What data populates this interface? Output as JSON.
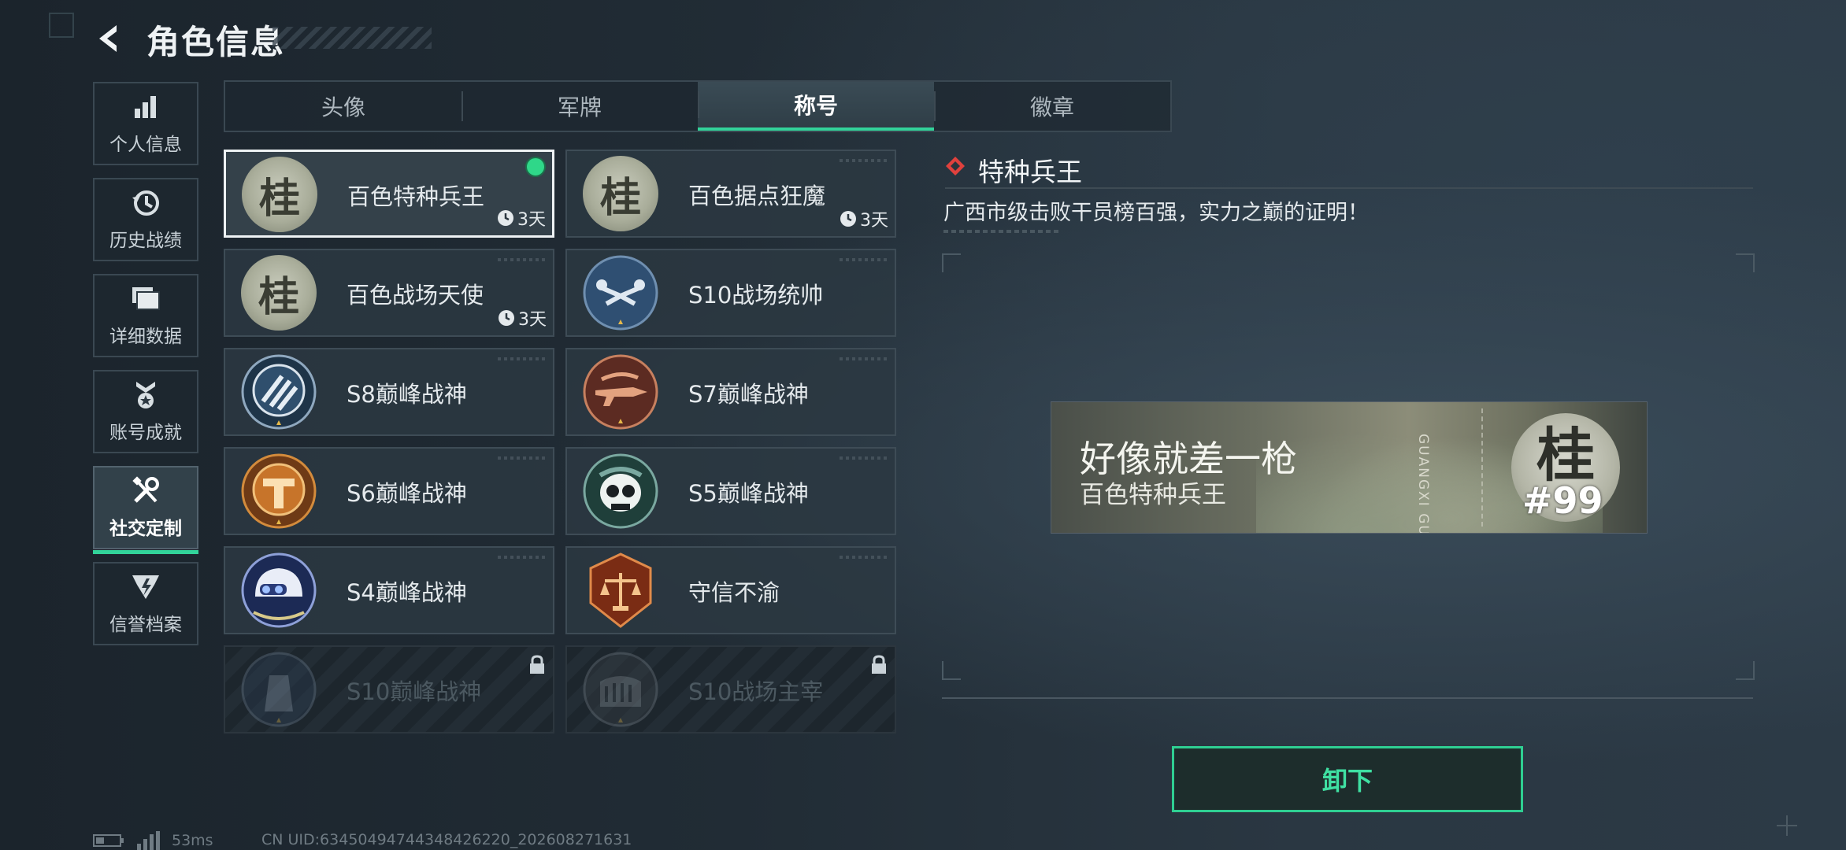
{
  "header": {
    "title": "角色信息"
  },
  "sidebar": {
    "items": [
      {
        "label": "个人信息",
        "icon": "bar-chart-icon",
        "active": false
      },
      {
        "label": "历史战绩",
        "icon": "history-clock-icon",
        "active": false
      },
      {
        "label": "详细数据",
        "icon": "folder-icon",
        "active": false
      },
      {
        "label": "账号成就",
        "icon": "achievement-medal-icon",
        "active": false
      },
      {
        "label": "社交定制",
        "icon": "wrench-screwdriver-icon",
        "active": true
      },
      {
        "label": "信誉档案",
        "icon": "credit-shield-icon",
        "active": false
      }
    ]
  },
  "tabs": [
    {
      "label": "头像",
      "active": false
    },
    {
      "label": "军牌",
      "active": false
    },
    {
      "label": "称号",
      "active": true
    },
    {
      "label": "徽章",
      "active": false
    }
  ],
  "titles": [
    {
      "name": "百色特种兵王",
      "time": "3天",
      "badge": "gui-emblem-badge",
      "selected": true,
      "equipped": true,
      "locked": false
    },
    {
      "name": "百色据点狂魔",
      "time": "3天",
      "badge": "gui-emblem-badge",
      "selected": false,
      "equipped": false,
      "locked": false
    },
    {
      "name": "百色战场天使",
      "time": "3天",
      "badge": "gui-emblem-badge",
      "selected": false,
      "equipped": false,
      "locked": false
    },
    {
      "name": "S10战场统帅",
      "time": "",
      "badge": "drone-badge",
      "selected": false,
      "equipped": false,
      "locked": false
    },
    {
      "name": "S8巅峰战神",
      "time": "",
      "badge": "stripes-badge",
      "selected": false,
      "equipped": false,
      "locked": false
    },
    {
      "name": "S7巅峰战神",
      "time": "",
      "badge": "rifle-badge",
      "selected": false,
      "equipped": false,
      "locked": false
    },
    {
      "name": "S6巅峰战神",
      "time": "",
      "badge": "t-shield-badge",
      "selected": false,
      "equipped": false,
      "locked": false
    },
    {
      "name": "S5巅峰战神",
      "time": "",
      "badge": "skull-badge",
      "selected": false,
      "equipped": false,
      "locked": false
    },
    {
      "name": "S4巅峰战神",
      "time": "",
      "badge": "helmet-badge",
      "selected": false,
      "equipped": false,
      "locked": false
    },
    {
      "name": "守信不渝",
      "time": "",
      "badge": "scales-badge",
      "selected": false,
      "equipped": false,
      "locked": false
    },
    {
      "name": "S10巅峰战神",
      "time": "",
      "badge": "tower-badge",
      "selected": false,
      "equipped": false,
      "locked": true
    },
    {
      "name": "S10战场主宰",
      "time": "",
      "badge": "colosseum-badge",
      "selected": false,
      "equipped": false,
      "locked": true
    }
  ],
  "detail": {
    "title": "特种兵王",
    "description": "广西市级击败干员榜百强，实力之巅的证明！",
    "banner": {
      "headline": "好像就差一枪",
      "subtitle": "百色特种兵王",
      "side_text": "GUANGXI GUI",
      "emblem_char": "桂",
      "rank": "#99"
    },
    "action_label": "卸下"
  },
  "status": {
    "ping": "53ms",
    "uid": "CN UID:6345049474434842622​0_202608271631"
  },
  "colors": {
    "accent_green": "#32d39a",
    "equipped_dot": "#2fd789",
    "diamond_red": "#e0413d"
  }
}
